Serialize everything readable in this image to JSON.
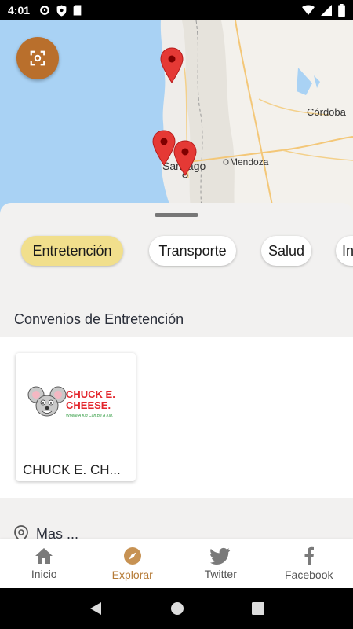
{
  "status_bar": {
    "time": "4:01",
    "left_icons": [
      "gear-icon",
      "shield-icon",
      "sd-card-icon"
    ],
    "right_icons": [
      "wifi-icon",
      "signal-icon",
      "battery-icon"
    ]
  },
  "map": {
    "labels": [
      "Córdoba",
      "Mendoza",
      "Santiago"
    ],
    "markers": 3
  },
  "categories": {
    "chips": [
      {
        "label": "Entretención",
        "active": true
      },
      {
        "label": "Transporte",
        "active": false
      },
      {
        "label": "Salud",
        "active": false
      },
      {
        "label": "In",
        "active": false
      }
    ]
  },
  "section": {
    "title": "Convenios de Entretención",
    "cards": [
      {
        "name": "CHUCK E. CH...",
        "logo_line1": "CHUCK E.",
        "logo_line2": "CHEESE.",
        "logo_tagline": "Where A Kid Can Be A Kid."
      }
    ]
  },
  "next_section": {
    "title": "Mas ...",
    "icon": "location-pin-icon"
  },
  "bottom_nav": {
    "items": [
      {
        "label": "Inicio",
        "icon": "home-icon",
        "active": false
      },
      {
        "label": "Explorar",
        "icon": "compass-icon",
        "active": true
      },
      {
        "label": "Twitter",
        "icon": "twitter-icon",
        "active": false
      },
      {
        "label": "Facebook",
        "icon": "facebook-icon",
        "active": false
      }
    ]
  },
  "colors": {
    "accent": "#b96f2c",
    "active_chip": "#f1df8c",
    "active_nav": "#b57a36",
    "marker": "#e53935"
  }
}
